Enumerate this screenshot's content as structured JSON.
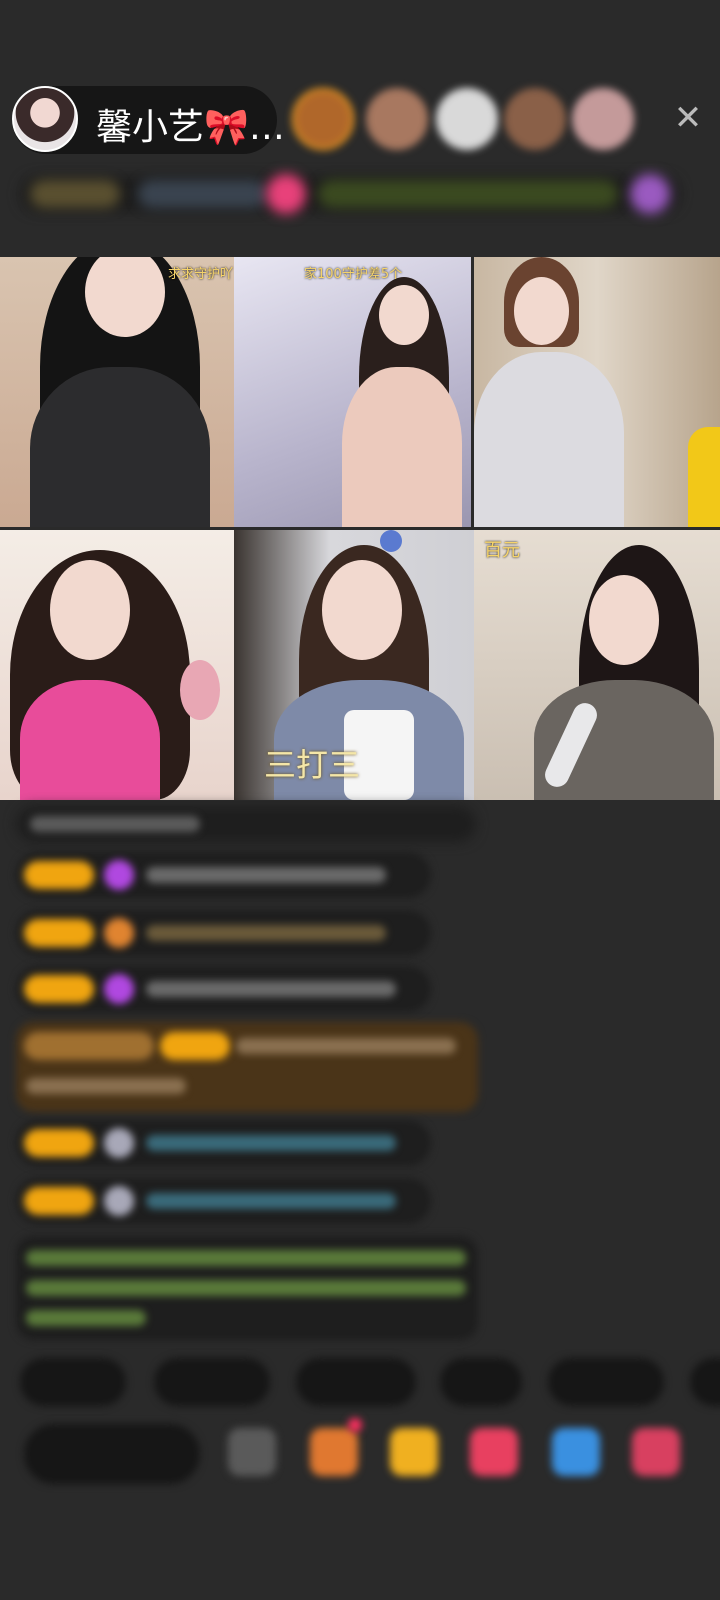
{
  "host": {
    "name": "馨小艺🎀…"
  },
  "tiles": [
    {
      "caption": "求求守护吖"
    },
    {
      "caption": "家100守护差5个"
    },
    {
      "caption": ""
    },
    {
      "caption": ""
    },
    {
      "caption": ""
    },
    {
      "caption": "百元"
    }
  ],
  "overlay_text": "三打三",
  "colors": {
    "background": "#2a2a2a",
    "badge": "#f0a510",
    "accent_pink": "#e8417a",
    "green_text": "#8fd06a"
  },
  "icons": [
    "close-icon",
    "gift-icon",
    "heart-icon",
    "chat-icon",
    "menu-icon"
  ]
}
